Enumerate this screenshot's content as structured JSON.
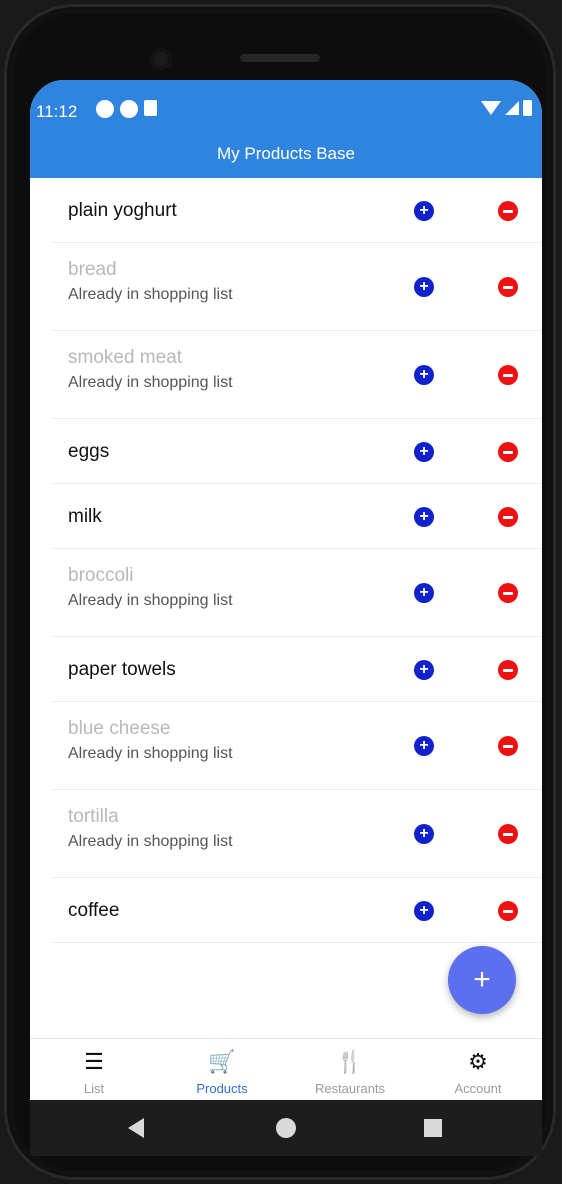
{
  "status_bar": {
    "time": "11:12"
  },
  "app_bar": {
    "title": "My Products Base"
  },
  "products": [
    {
      "name": "plain yoghurt",
      "status": ""
    },
    {
      "name": "bread",
      "status": "Already in shopping list"
    },
    {
      "name": "smoked meat",
      "status": "Already in shopping list"
    },
    {
      "name": "eggs",
      "status": ""
    },
    {
      "name": "milk",
      "status": ""
    },
    {
      "name": "broccoli",
      "status": "Already in shopping list"
    },
    {
      "name": "paper towels",
      "status": ""
    },
    {
      "name": "blue cheese",
      "status": "Already in shopping list"
    },
    {
      "name": "tortilla",
      "status": "Already in shopping list"
    },
    {
      "name": "coffee",
      "status": ""
    }
  ],
  "fab": {
    "label": "+",
    "icon": "plus-icon"
  },
  "bottom_nav": [
    {
      "label": "List",
      "icon": "list-icon",
      "glyph": "☰",
      "active": false
    },
    {
      "label": "Products",
      "icon": "cart-icon",
      "glyph": "🛒",
      "active": true
    },
    {
      "label": "Restaurants",
      "icon": "fork-knife-icon",
      "glyph": "🍴",
      "active": false
    },
    {
      "label": "Account",
      "icon": "gears-icon",
      "glyph": "⚙",
      "active": false
    }
  ],
  "colors": {
    "app_bar": "#2f84df",
    "add_button": "#1122cc",
    "remove_button": "#ee1111",
    "fab": "#5b6ff0",
    "active_tab": "#2f6fd6"
  }
}
